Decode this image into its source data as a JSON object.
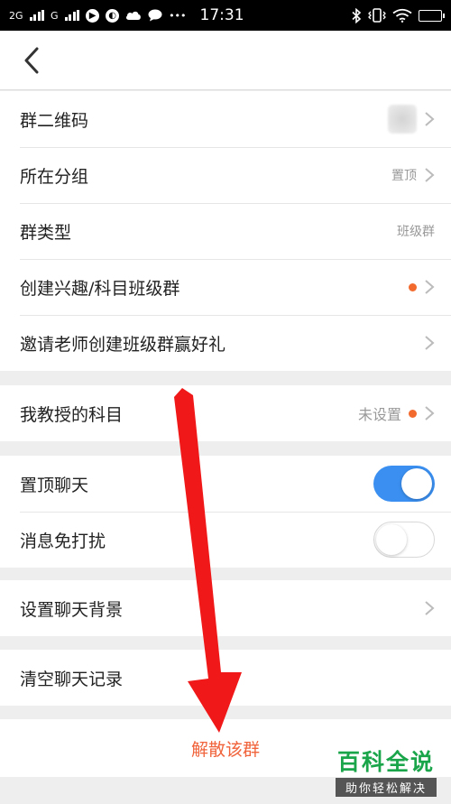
{
  "status_bar": {
    "signal1": "2G",
    "signal2": "G",
    "time": "17:31",
    "more": "•••"
  },
  "header": {
    "back_icon": "chevron-left-icon"
  },
  "group1": {
    "items": [
      {
        "label": "群二维码",
        "value": ""
      },
      {
        "label": "所在分组",
        "value": "置顶"
      },
      {
        "label": "群类型",
        "value": "班级群"
      },
      {
        "label": "创建兴趣/科目班级群",
        "value": ""
      },
      {
        "label": "邀请老师创建班级群赢好礼",
        "value": ""
      }
    ]
  },
  "group2": {
    "items": [
      {
        "label": "我教授的科目",
        "value": "未设置"
      }
    ]
  },
  "group3": {
    "items": [
      {
        "label": "置顶聊天",
        "toggle": "on"
      },
      {
        "label": "消息免打扰",
        "toggle": "off"
      }
    ]
  },
  "group4": {
    "items": [
      {
        "label": "设置聊天背景"
      }
    ]
  },
  "group5": {
    "items": [
      {
        "label": "清空聊天记录"
      }
    ]
  },
  "dissolve": {
    "label": "解散该群"
  },
  "watermark": {
    "main": "百科全说",
    "sub": "助你轻松解决"
  },
  "colors": {
    "accent_blue": "#3a8ff0",
    "danger_orange": "#f0633b",
    "badge_dot": "#f26a2e",
    "annotation_arrow": "#f01818",
    "watermark_green": "#1aa54a"
  }
}
